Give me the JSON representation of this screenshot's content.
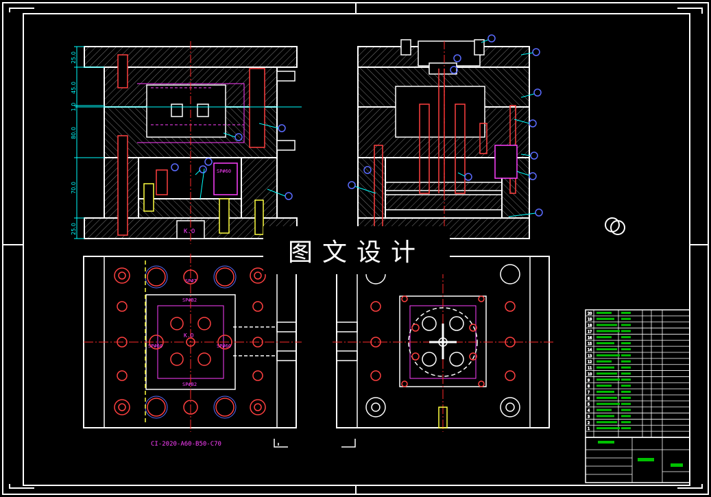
{
  "watermark": "图文设计",
  "part_code": "CI-2020-A60-B50-C70",
  "colors": {
    "background": "#000000",
    "outline": "#ffffff",
    "centerline": "#ff2a2a",
    "dimension": "#00ffff",
    "callout": "#5b6cff",
    "magenta": "#ff40ff",
    "table": "#00ff00",
    "hatch": "#8a8a8a",
    "yellow": "#ffff40"
  },
  "dimensions": [
    "25.0",
    "45.0",
    "1.0",
    "80.0",
    "70.0",
    "25.0"
  ],
  "labels": {
    "sp_left": "SP#60",
    "kd_left": "K.O",
    "plate_top": "SP#B2",
    "plate_bottom": "SP#B2",
    "plate_side_left": "SP#60",
    "plate_side_right": "SP#60",
    "kd_plan": "K.O",
    "pin_top": "SP#7"
  },
  "title_block": {
    "rows": [
      "1",
      "2",
      "3",
      "4",
      "5",
      "6",
      "7",
      "8",
      "9",
      "10",
      "11",
      "12",
      "13",
      "14",
      "15",
      "16",
      "17",
      "18",
      "19",
      "20"
    ]
  }
}
